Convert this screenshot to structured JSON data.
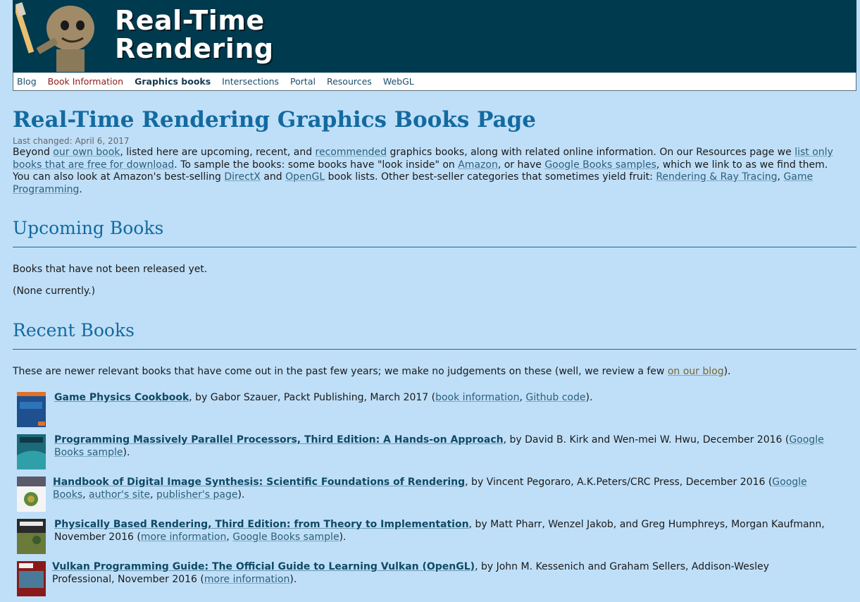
{
  "header": {
    "title_line1": "Real-Time",
    "title_line2": "Rendering"
  },
  "nav": {
    "items": [
      "Blog",
      "Book Information",
      "Graphics books",
      "Intersections",
      "Portal",
      "Resources",
      "WebGL"
    ]
  },
  "page": {
    "title": "Real-Time Rendering Graphics Books Page",
    "last_changed": "Last changed: April 6, 2017",
    "intro": {
      "t1": "Beyond ",
      "l1": "our own book",
      "t2": ", listed here are upcoming, recent, and ",
      "l2": "recommended",
      "t3": " graphics books, along with related online information. On our Resources page we ",
      "l3": "list only books that are free for download",
      "t4": ". To sample the books: some books have \"look inside\" on ",
      "l4": "Amazon",
      "t5": ", or have ",
      "l5": "Google Books samples",
      "t6": ", which we link to as we find them. You can also look at Amazon's best-selling ",
      "l6": "DirectX",
      "t7": " and ",
      "l7": "OpenGL",
      "t8": " book lists. Other best-seller categories that sometimes yield fruit: ",
      "l8": "Rendering & Ray Tracing",
      "t9": ", ",
      "l9": "Game Programming",
      "t10": "."
    }
  },
  "upcoming": {
    "heading": "Upcoming Books",
    "desc": "Books that have not been released yet.",
    "none": "(None currently.)"
  },
  "recent": {
    "heading": "Recent Books",
    "desc_text": "These are newer relevant books that have come out in the past few years; we make no judgements on these (well, we review a few ",
    "desc_link": "on our blog",
    "desc_end": ").",
    "books": [
      {
        "title": "Game Physics Cookbook",
        "meta": ", by Gabor Szauer, Packt Publishing, March 2017 (",
        "link1": "book information",
        "sep1": ", ",
        "link2": "Github code",
        "sep2": "",
        "link3": "",
        "end": ")."
      },
      {
        "title": "Programming Massively Parallel Processors, Third Edition: A Hands-on Approach",
        "meta": ", by David B. Kirk and Wen-mei W. Hwu, December 2016 (",
        "link1": "Google Books sample",
        "sep1": "",
        "link2": "",
        "sep2": "",
        "link3": "",
        "end": ")."
      },
      {
        "title": "Handbook of Digital Image Synthesis: Scientific Foundations of Rendering",
        "meta": ", by Vincent Pegoraro, A.K.Peters/CRC Press, December 2016 (",
        "link1": "Google Books",
        "sep1": ", ",
        "link2": "author's site",
        "sep2": ", ",
        "link3": "publisher's page",
        "end": ")."
      },
      {
        "title": "Physically Based Rendering, Third Edition: from Theory to Implementation",
        "meta": ", by Matt Pharr, Wenzel Jakob, and Greg Humphreys, Morgan Kaufmann, November 2016 (",
        "link1": "more information",
        "sep1": ", ",
        "link2": "Google Books sample",
        "sep2": "",
        "link3": "",
        "end": ")."
      },
      {
        "title": "Vulkan Programming Guide: The Official Guide to Learning Vulkan (OpenGL)",
        "meta": ", by John M. Kessenich and Graham Sellers, Addison-Wesley Professional, November 2016 (",
        "link1": "more information",
        "sep1": "",
        "link2": "",
        "sep2": "",
        "link3": "",
        "end": ")."
      }
    ]
  }
}
